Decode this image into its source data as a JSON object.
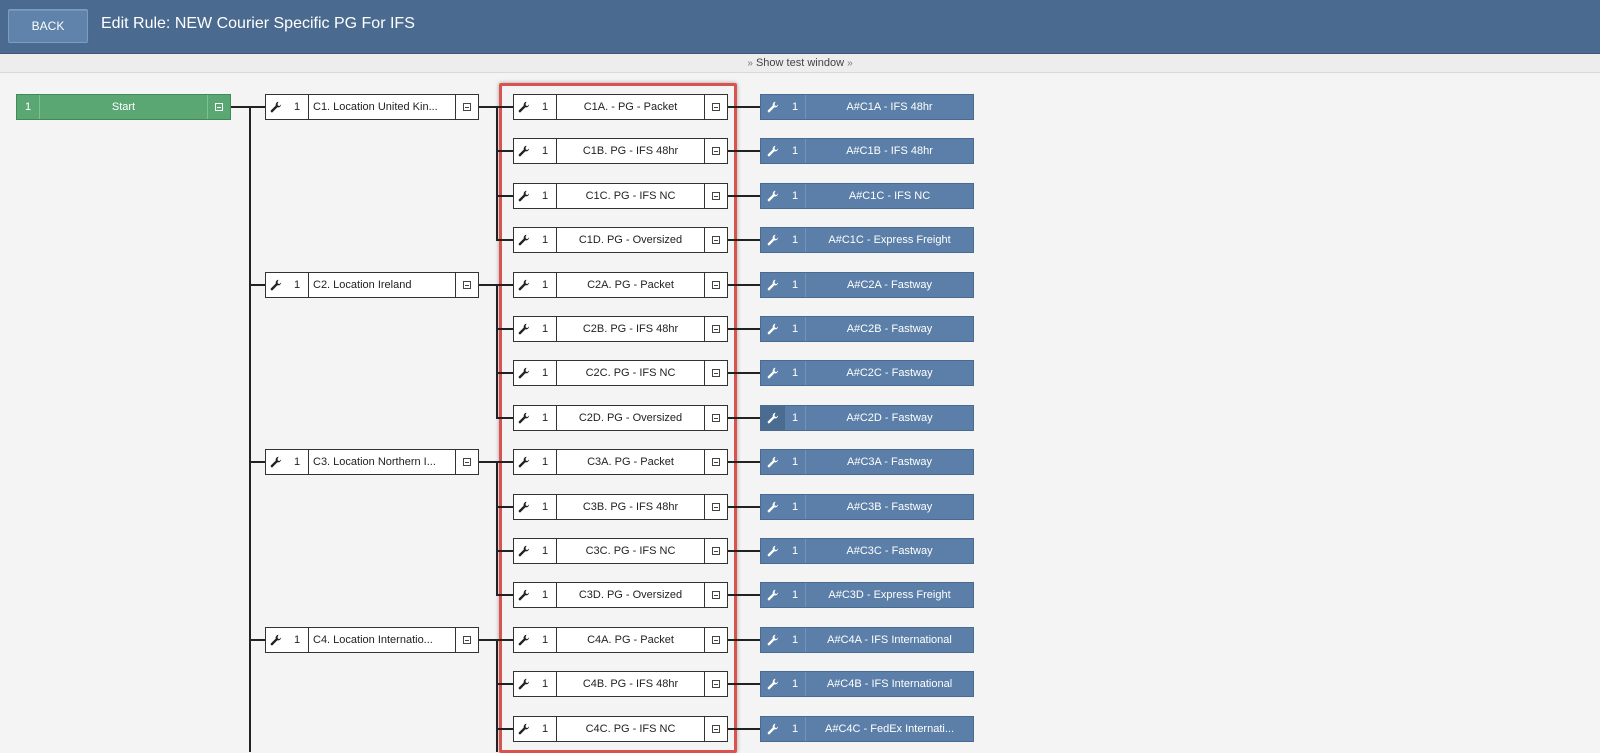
{
  "header": {
    "back_label": "BACK",
    "title": "Edit Rule: NEW Courier Specific PG For IFS"
  },
  "test_window": {
    "label": "Show test window"
  },
  "icons": {
    "edit": "wrench-icon",
    "collapse": "collapse-minus-icon",
    "expand_chevron": "double-chevron-down-icon"
  },
  "colors": {
    "header": "#4a6b8f",
    "start": "#5aa774",
    "action": "#5b7fa8",
    "highlight": "#d9534f"
  },
  "start_node": {
    "number": "1",
    "label": "Start"
  },
  "locations": [
    {
      "number": "1",
      "label": "C1. Location United Kin..."
    },
    {
      "number": "1",
      "label": "C2. Location Ireland"
    },
    {
      "number": "1",
      "label": "C3. Location Northern I..."
    },
    {
      "number": "1",
      "label": "C4. Location Internatio..."
    }
  ],
  "conditions": [
    {
      "number": "1",
      "label": "C1A. - PG - Packet"
    },
    {
      "number": "1",
      "label": "C1B. PG - IFS 48hr"
    },
    {
      "number": "1",
      "label": "C1C. PG - IFS NC"
    },
    {
      "number": "1",
      "label": "C1D. PG - Oversized"
    },
    {
      "number": "1",
      "label": "C2A. PG - Packet"
    },
    {
      "number": "1",
      "label": "C2B. PG - IFS 48hr"
    },
    {
      "number": "1",
      "label": "C2C. PG - IFS NC"
    },
    {
      "number": "1",
      "label": "C2D. PG - Oversized"
    },
    {
      "number": "1",
      "label": "C3A. PG - Packet"
    },
    {
      "number": "1",
      "label": "C3B. PG - IFS 48hr"
    },
    {
      "number": "1",
      "label": "C3C. PG - IFS NC"
    },
    {
      "number": "1",
      "label": "C3D. PG - Oversized"
    },
    {
      "number": "1",
      "label": "C4A. PG - Packet"
    },
    {
      "number": "1",
      "label": "C4B. PG - IFS 48hr"
    },
    {
      "number": "1",
      "label": "C4C. PG - IFS NC"
    }
  ],
  "actions": [
    {
      "number": "1",
      "label": "A#C1A - IFS 48hr"
    },
    {
      "number": "1",
      "label": "A#C1B - IFS 48hr"
    },
    {
      "number": "1",
      "label": "A#C1C - IFS NC"
    },
    {
      "number": "1",
      "label": "A#C1C - Express Freight"
    },
    {
      "number": "1",
      "label": "A#C2A - Fastway"
    },
    {
      "number": "1",
      "label": "A#C2B - Fastway"
    },
    {
      "number": "1",
      "label": "A#C2C - Fastway"
    },
    {
      "number": "1",
      "label": "A#C2D - Fastway"
    },
    {
      "number": "1",
      "label": "A#C3A - Fastway"
    },
    {
      "number": "1",
      "label": "A#C3B - Fastway"
    },
    {
      "number": "1",
      "label": "A#C3C - Fastway"
    },
    {
      "number": "1",
      "label": "A#C3D - Express Freight"
    },
    {
      "number": "1",
      "label": "A#C4A - IFS International"
    },
    {
      "number": "1",
      "label": "A#C4B - IFS International"
    },
    {
      "number": "1",
      "label": "A#C4C - FedEx Internati..."
    }
  ]
}
